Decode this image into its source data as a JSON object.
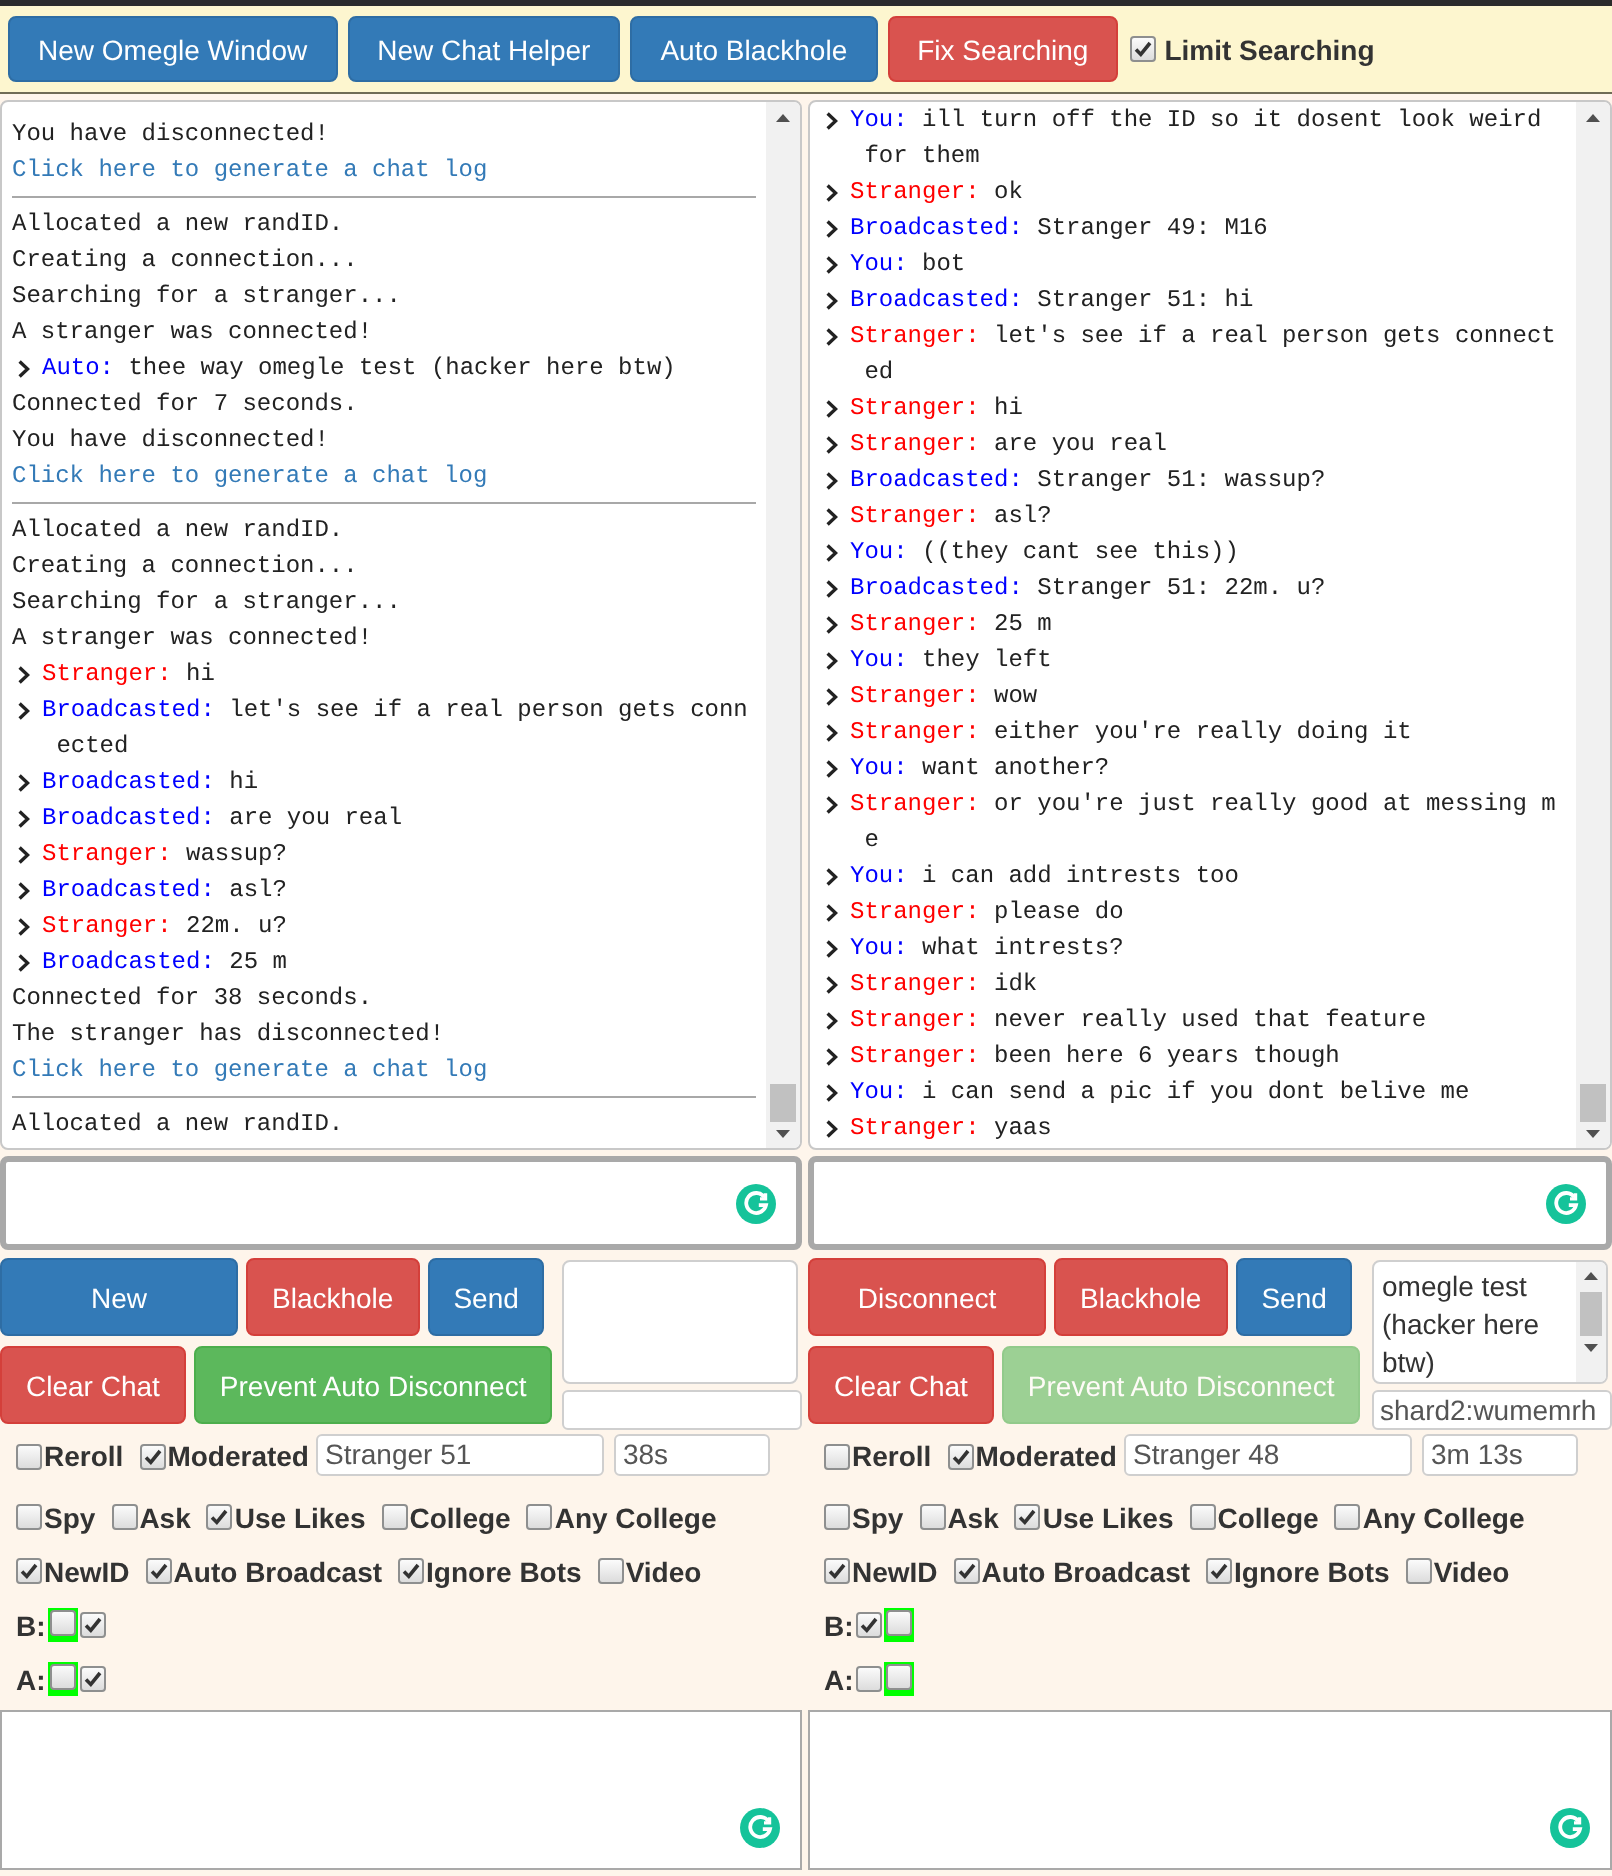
{
  "toolbar": {
    "buttons": [
      {
        "label": "New Omegle Window",
        "kind": "primary"
      },
      {
        "label": "New Chat Helper",
        "kind": "primary"
      },
      {
        "label": "Auto Blackhole",
        "kind": "primary"
      },
      {
        "label": "Fix Searching",
        "kind": "danger"
      }
    ],
    "limit_searching": {
      "label": "Limit Searching",
      "checked": true
    }
  },
  "panels": [
    {
      "log": {
        "sessions": [
          [
            {
              "kind": "status",
              "text": "You have disconnected!"
            },
            {
              "kind": "link",
              "text": "Click here to generate a chat log"
            }
          ],
          [
            {
              "kind": "status",
              "text": "Allocated a new randID."
            },
            {
              "kind": "status",
              "text": "Creating a connection..."
            },
            {
              "kind": "status",
              "text": "Searching for a stranger..."
            },
            {
              "kind": "status",
              "text": "A stranger was connected!"
            },
            {
              "kind": "message",
              "speaker": "Auto:",
              "color": "#0000ff",
              "text": "thee way omegle test (hacker here btw)"
            },
            {
              "kind": "status",
              "text": "Connected for 7 seconds."
            },
            {
              "kind": "status",
              "text": "You have disconnected!"
            },
            {
              "kind": "link",
              "text": "Click here to generate a chat log"
            }
          ],
          [
            {
              "kind": "status",
              "text": "Allocated a new randID."
            },
            {
              "kind": "status",
              "text": "Creating a connection..."
            },
            {
              "kind": "status",
              "text": "Searching for a stranger..."
            },
            {
              "kind": "status",
              "text": "A stranger was connected!"
            },
            {
              "kind": "message",
              "speaker": "Stranger:",
              "color": "#ff0000",
              "text": "hi"
            },
            {
              "kind": "message",
              "speaker": "Broadcasted:",
              "color": "#0000ff",
              "text": "let's see if a real person gets connected"
            },
            {
              "kind": "message",
              "speaker": "Broadcasted:",
              "color": "#0000ff",
              "text": "hi"
            },
            {
              "kind": "message",
              "speaker": "Broadcasted:",
              "color": "#0000ff",
              "text": "are you real"
            },
            {
              "kind": "message",
              "speaker": "Stranger:",
              "color": "#ff0000",
              "text": "wassup?"
            },
            {
              "kind": "message",
              "speaker": "Broadcasted:",
              "color": "#0000ff",
              "text": "asl?"
            },
            {
              "kind": "message",
              "speaker": "Stranger:",
              "color": "#ff0000",
              "text": "22m. u?"
            },
            {
              "kind": "message",
              "speaker": "Broadcasted:",
              "color": "#0000ff",
              "text": "25 m"
            },
            {
              "kind": "status",
              "text": "Connected for 38 seconds."
            },
            {
              "kind": "status",
              "text": "The stranger has disconnected!"
            },
            {
              "kind": "link",
              "text": "Click here to generate a chat log"
            }
          ],
          [
            {
              "kind": "status",
              "text": "Allocated a new randID."
            }
          ]
        ]
      },
      "button_rows": [
        [
          {
            "label": "New",
            "kind": "primary",
            "disabled": false
          },
          {
            "label": "Blackhole",
            "kind": "danger",
            "disabled": false
          },
          {
            "label": "Send",
            "kind": "primary",
            "disabled": false
          }
        ],
        [
          {
            "label": "Clear Chat",
            "kind": "danger",
            "disabled": false
          },
          {
            "label": "Prevent Auto Disconnect",
            "kind": "success",
            "disabled": false
          }
        ]
      ],
      "option_rows": [
        {
          "checkboxes": [
            {
              "label": "Reroll",
              "checked": false
            },
            {
              "label": "Moderated",
              "checked": true
            }
          ],
          "fields": [
            {
              "value": "Stranger 51"
            },
            {
              "value": "38s"
            }
          ]
        },
        {
          "checkboxes": [
            {
              "label": "Spy",
              "checked": false
            },
            {
              "label": "Ask",
              "checked": false
            },
            {
              "label": "Use Likes",
              "checked": true
            },
            {
              "label": "College",
              "checked": false
            },
            {
              "label": "Any College",
              "checked": false
            }
          ]
        },
        {
          "checkboxes": [
            {
              "label": "NewID",
              "checked": true
            },
            {
              "label": "Auto Broadcast",
              "checked": true
            },
            {
              "label": "Ignore Bots",
              "checked": true
            },
            {
              "label": "Video",
              "checked": false
            }
          ]
        }
      ],
      "toggle_rows": [
        {
          "label": "B:",
          "checkboxes": [
            {
              "checked": false,
              "highlighted": true
            },
            {
              "checked": true,
              "highlighted": false
            }
          ]
        },
        {
          "label": "A:",
          "checkboxes": [
            {
              "checked": false,
              "highlighted": true
            },
            {
              "checked": true,
              "highlighted": false
            }
          ]
        }
      ]
    },
    {
      "log": {
        "sessions": [
          [
            {
              "kind": "message",
              "speaker": "You:",
              "color": "#0000ff",
              "text": "ill turn off the ID so it dosent look weird for them"
            },
            {
              "kind": "message",
              "speaker": "Stranger:",
              "color": "#ff0000",
              "text": "ok"
            },
            {
              "kind": "message",
              "speaker": "Broadcasted:",
              "color": "#0000ff",
              "text": "Stranger 49: M16"
            },
            {
              "kind": "message",
              "speaker": "You:",
              "color": "#0000ff",
              "text": "bot"
            },
            {
              "kind": "message",
              "speaker": "Broadcasted:",
              "color": "#0000ff",
              "text": "Stranger 51: hi"
            },
            {
              "kind": "message",
              "speaker": "Stranger:",
              "color": "#ff0000",
              "text": "let's see if a real person gets connected"
            },
            {
              "kind": "message",
              "speaker": "Stranger:",
              "color": "#ff0000",
              "text": "hi"
            },
            {
              "kind": "message",
              "speaker": "Stranger:",
              "color": "#ff0000",
              "text": "are you real"
            },
            {
              "kind": "message",
              "speaker": "Broadcasted:",
              "color": "#0000ff",
              "text": "Stranger 51: wassup?"
            },
            {
              "kind": "message",
              "speaker": "Stranger:",
              "color": "#ff0000",
              "text": "asl?"
            },
            {
              "kind": "message",
              "speaker": "You:",
              "color": "#0000ff",
              "text": "((they cant see this))"
            },
            {
              "kind": "message",
              "speaker": "Broadcasted:",
              "color": "#0000ff",
              "text": "Stranger 51: 22m. u?"
            },
            {
              "kind": "message",
              "speaker": "Stranger:",
              "color": "#ff0000",
              "text": "25 m"
            },
            {
              "kind": "message",
              "speaker": "You:",
              "color": "#0000ff",
              "text": "they left"
            },
            {
              "kind": "message",
              "speaker": "Stranger:",
              "color": "#ff0000",
              "text": "wow"
            },
            {
              "kind": "message",
              "speaker": "Stranger:",
              "color": "#ff0000",
              "text": "either you're really doing it"
            },
            {
              "kind": "message",
              "speaker": "You:",
              "color": "#0000ff",
              "text": "want another?"
            },
            {
              "kind": "message",
              "speaker": "Stranger:",
              "color": "#ff0000",
              "text": "or you're just really good at messing me"
            },
            {
              "kind": "message",
              "speaker": "You:",
              "color": "#0000ff",
              "text": "i can add intrests too"
            },
            {
              "kind": "message",
              "speaker": "Stranger:",
              "color": "#ff0000",
              "text": "please do"
            },
            {
              "kind": "message",
              "speaker": "You:",
              "color": "#0000ff",
              "text": "what intrests?"
            },
            {
              "kind": "message",
              "speaker": "Stranger:",
              "color": "#ff0000",
              "text": "idk"
            },
            {
              "kind": "message",
              "speaker": "Stranger:",
              "color": "#ff0000",
              "text": "never really used that feature"
            },
            {
              "kind": "message",
              "speaker": "Stranger:",
              "color": "#ff0000",
              "text": "been here 6 years though"
            },
            {
              "kind": "message",
              "speaker": "You:",
              "color": "#0000ff",
              "text": "i can send a pic if you dont belive me"
            },
            {
              "kind": "message",
              "speaker": "Stranger:",
              "color": "#ff0000",
              "text": "yaas"
            }
          ]
        ]
      },
      "button_rows": [
        [
          {
            "label": "Disconnect",
            "kind": "danger",
            "disabled": false
          },
          {
            "label": "Blackhole",
            "kind": "danger",
            "disabled": false
          },
          {
            "label": "Send",
            "kind": "primary",
            "disabled": false
          }
        ],
        [
          {
            "label": "Clear Chat",
            "kind": "danger",
            "disabled": false
          },
          {
            "label": "Prevent Auto Disconnect",
            "kind": "success",
            "disabled": true
          }
        ]
      ],
      "side_box": {
        "value": "omegle test (hacker here btw)"
      },
      "id_field": {
        "value": "shard2:wumemrh"
      },
      "option_rows": [
        {
          "checkboxes": [
            {
              "label": "Reroll",
              "checked": false
            },
            {
              "label": "Moderated",
              "checked": true
            }
          ],
          "fields": [
            {
              "value": "Stranger 48"
            },
            {
              "value": "3m 13s"
            }
          ]
        },
        {
          "checkboxes": [
            {
              "label": "Spy",
              "checked": false
            },
            {
              "label": "Ask",
              "checked": false
            },
            {
              "label": "Use Likes",
              "checked": true
            },
            {
              "label": "College",
              "checked": false
            },
            {
              "label": "Any College",
              "checked": false
            }
          ]
        },
        {
          "checkboxes": [
            {
              "label": "NewID",
              "checked": true
            },
            {
              "label": "Auto Broadcast",
              "checked": true
            },
            {
              "label": "Ignore Bots",
              "checked": true
            },
            {
              "label": "Video",
              "checked": false
            }
          ]
        }
      ],
      "toggle_rows": [
        {
          "label": "B:",
          "checkboxes": [
            {
              "checked": true,
              "highlighted": false
            },
            {
              "checked": false,
              "highlighted": true
            }
          ]
        },
        {
          "label": "A:",
          "checkboxes": [
            {
              "checked": false,
              "highlighted": false
            },
            {
              "checked": false,
              "highlighted": true
            }
          ]
        }
      ]
    }
  ]
}
